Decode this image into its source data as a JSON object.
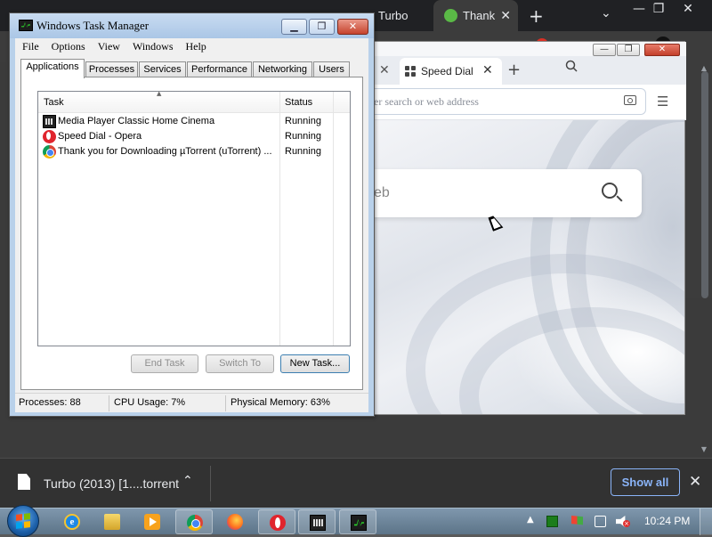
{
  "chrome": {
    "tabs": [
      {
        "label": "Turbo"
      },
      {
        "label": "Thank"
      }
    ],
    "new_tab": "+",
    "dropdown": "⌄",
    "window_controls": {
      "minimize": "—",
      "restore": "❐",
      "close": "✕"
    }
  },
  "download_bar": {
    "file_name": "Turbo (2013) [1....torrent",
    "chevron": "⌃",
    "show_all": "Show all",
    "close": "✕"
  },
  "opera": {
    "tab_close_left": "✕",
    "tab_label": "Speed Dial",
    "tab_close": "✕",
    "new_tab": "+",
    "address_placeholder": "er search or web address",
    "search_placeholder": "eb",
    "settings_icon": "☰",
    "window_controls": {
      "minimize": "—",
      "restore": "❐",
      "close": "✕"
    }
  },
  "task_manager": {
    "title": "Windows Task Manager",
    "window_controls": {
      "minimize": "▁",
      "restore": "❐",
      "close": "✕"
    },
    "menu": [
      "File",
      "Options",
      "View",
      "Windows",
      "Help"
    ],
    "tabs": [
      "Applications",
      "Processes",
      "Services",
      "Performance",
      "Networking",
      "Users"
    ],
    "active_tab": "Applications",
    "columns": {
      "task": "Task",
      "status": "Status",
      "sort": "▲"
    },
    "rows": [
      {
        "task": "Media Player Classic Home Cinema",
        "status": "Running",
        "icon": "mpc-icon"
      },
      {
        "task": "Speed Dial - Opera",
        "status": "Running",
        "icon": "opera-icon"
      },
      {
        "task": "Thank you for Downloading µTorrent (uTorrent) ...",
        "status": "Running",
        "icon": "chrome-icon"
      }
    ],
    "buttons": {
      "end_task": "End Task",
      "switch_to": "Switch To",
      "new_task": "New Task..."
    },
    "status_bar": {
      "processes": "Processes: 88",
      "cpu": "CPU Usage: 7%",
      "memory": "Physical Memory: 63%"
    }
  },
  "taskbar": {
    "tray_up": "▲",
    "time": "10:24 PM",
    "volume_muted": "×"
  }
}
